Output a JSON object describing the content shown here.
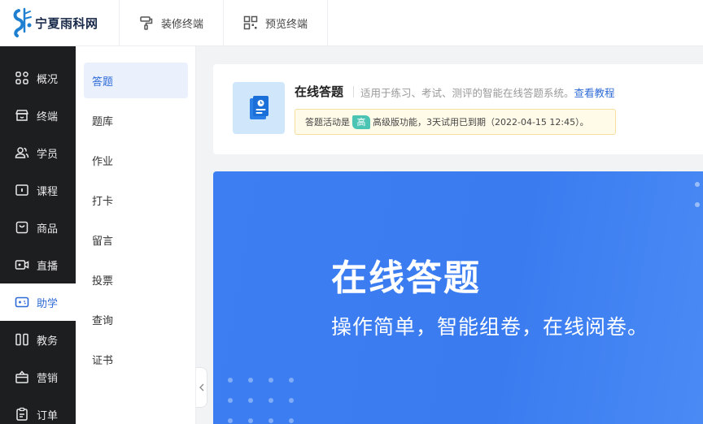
{
  "header": {
    "logo_text": "宁夏雨科网",
    "tabs": [
      {
        "label": "装修终端",
        "icon": "paint-roller-icon"
      },
      {
        "label": "预览终端",
        "icon": "qr-code-icon"
      }
    ]
  },
  "leftnav": {
    "items": [
      {
        "label": "概况",
        "icon": "dashboard-grid-icon"
      },
      {
        "label": "终端",
        "icon": "storefront-icon"
      },
      {
        "label": "学员",
        "icon": "users-icon"
      },
      {
        "label": "课程",
        "icon": "course-screen-icon"
      },
      {
        "label": "商品",
        "icon": "bag-icon"
      },
      {
        "label": "直播",
        "icon": "video-camera-icon"
      },
      {
        "label": "助学",
        "icon": "gamepad-icon",
        "active": true
      },
      {
        "label": "教务",
        "icon": "book-columns-icon"
      },
      {
        "label": "营销",
        "icon": "gift-icon"
      },
      {
        "label": "订单",
        "icon": "clipboard-icon"
      }
    ]
  },
  "subnav": {
    "items": [
      {
        "label": "答题",
        "active": true
      },
      {
        "label": "题库"
      },
      {
        "label": "作业"
      },
      {
        "label": "打卡"
      },
      {
        "label": "留言"
      },
      {
        "label": "投票"
      },
      {
        "label": "查询"
      },
      {
        "label": "证书"
      }
    ]
  },
  "info": {
    "title": "在线答题",
    "description": "适用于练习、考试、测评的智能在线答题系统。",
    "link": "查看教程",
    "notice_prefix": "答题活动是",
    "notice_badge": "高",
    "notice_suffix": "高级版功能，3天试用已到期（2022-04-15 12:45）。"
  },
  "banner": {
    "title": "在线答题",
    "subtitle": "操作简单，智能组卷，在线阅卷。"
  },
  "colors": {
    "accent": "#2f6bd6",
    "nav_bg": "#1d1e20",
    "banner_bg": "#3d7ff2",
    "notice_bg": "#fffbe8",
    "badge": "#4cc4b4"
  }
}
